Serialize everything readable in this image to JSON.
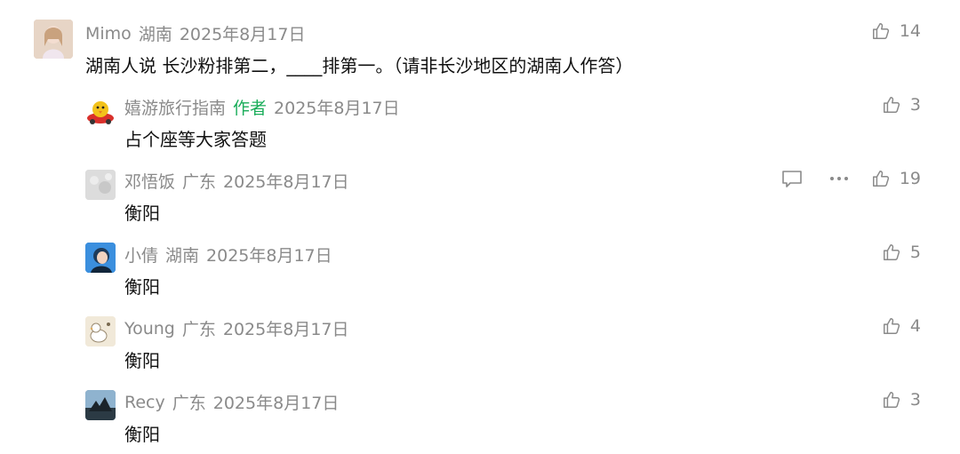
{
  "comments": [
    {
      "user": "Mimo",
      "region": "湖南",
      "date": "2025年8月17日",
      "text": "湖南人说 长沙粉排第二，____排第一。（请非长沙地区的湖南人作答）",
      "likes": "14",
      "avatar_color": "#d9c2b0"
    },
    {
      "user": "嬉游旅行指南",
      "author_tag": "作者",
      "date": "2025年8月17日",
      "text": "占个座等大家答题",
      "likes": "3",
      "avatar_color": "#f2c21b"
    },
    {
      "user": "邓悟饭",
      "region": "广东",
      "date": "2025年8月17日",
      "text": "衡阳",
      "likes": "19",
      "avatar_color": "#d7d7d7"
    },
    {
      "user": "小倩",
      "region": "湖南",
      "date": "2025年8月17日",
      "text": "衡阳",
      "likes": "5",
      "avatar_color": "#2a7fd0"
    },
    {
      "user": "Young",
      "region": "广东",
      "date": "2025年8月17日",
      "text": "衡阳",
      "likes": "4",
      "avatar_color": "#efe6d5"
    },
    {
      "user": "Recy",
      "region": "广东",
      "date": "2025年8月17日",
      "text": "衡阳",
      "likes": "3",
      "avatar_color": "#5f7f97"
    }
  ]
}
